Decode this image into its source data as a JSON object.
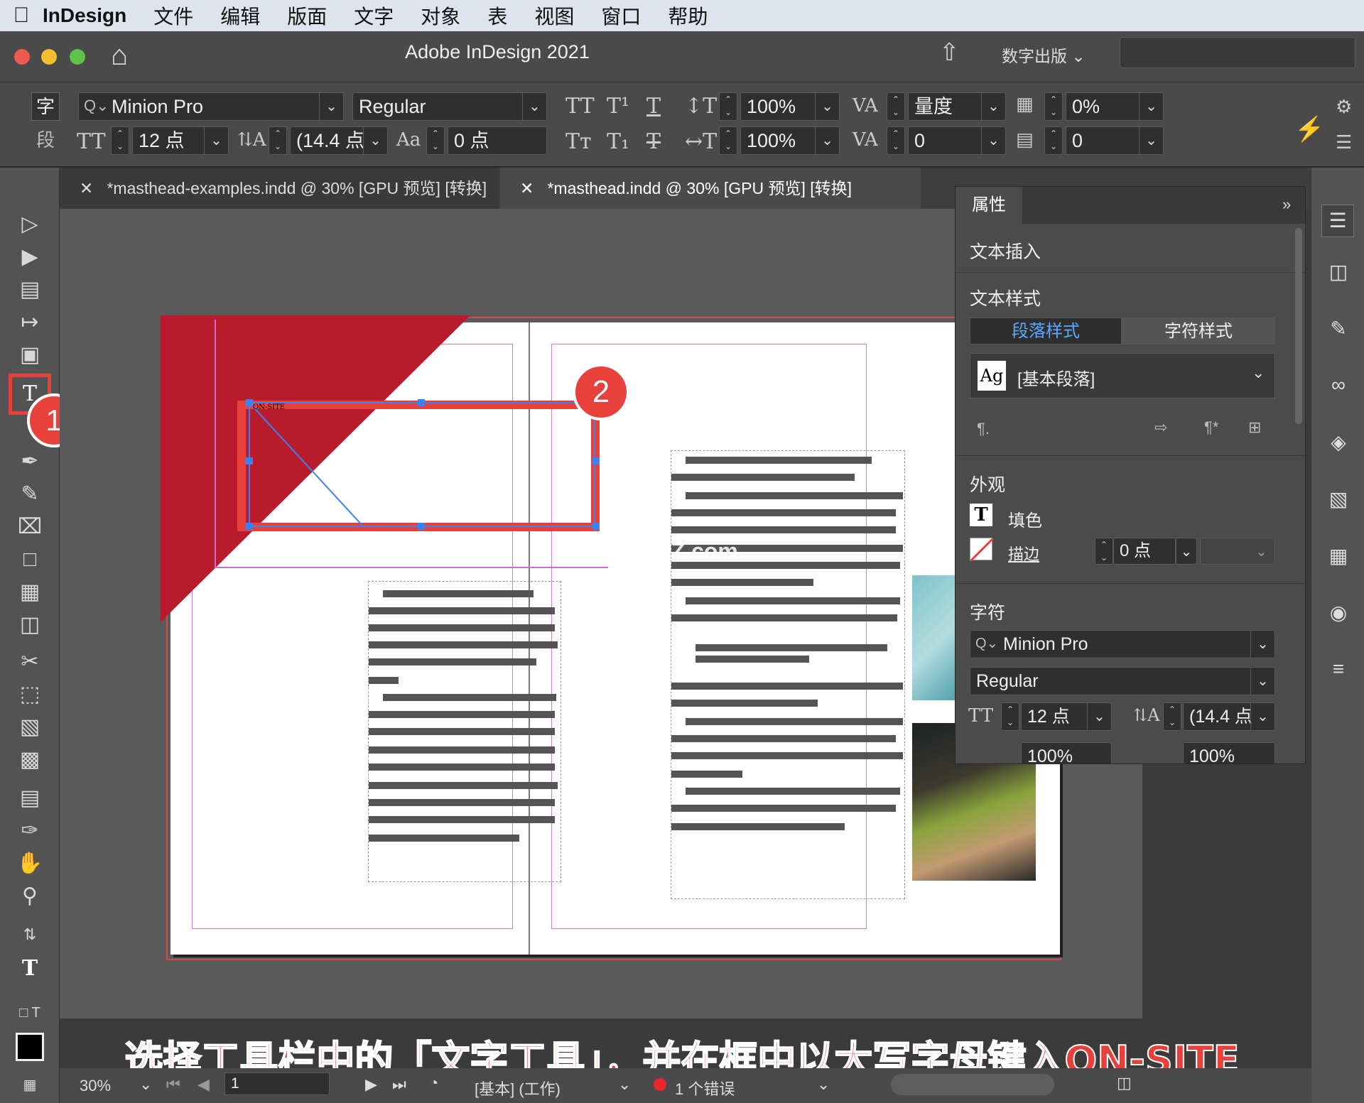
{
  "menubar": {
    "app": "InDesign",
    "items": [
      "文件",
      "编辑",
      "版面",
      "文字",
      "对象",
      "表",
      "视图",
      "窗口",
      "帮助"
    ]
  },
  "window": {
    "title": "Adobe InDesign 2021",
    "workspace": "数字出版"
  },
  "control": {
    "char_label": "字",
    "para_label": "段",
    "font": "Minion Pro",
    "style": "Regular",
    "size": "12 点",
    "leading": "(14.4 点",
    "baseline": "0 点",
    "vscale": "100%",
    "hscale": "100%",
    "kern": "量度",
    "track": "0",
    "skew": "0%",
    "skew2": "0"
  },
  "tabs": [
    {
      "label": "*masthead-examples.indd @ 30% [GPU 预览] [转换]"
    },
    {
      "label": "*masthead.indd @ 30% [GPU 预览] [转换]"
    }
  ],
  "properties": {
    "tab": "属性",
    "text_insert": "文本插入",
    "text_style": "文本样式",
    "para_style_tab": "段落样式",
    "char_style_tab": "字符样式",
    "para_style_value": "[基本段落]",
    "appearance": "外观",
    "fill": "填色",
    "stroke": "描边",
    "stroke_weight": "0 点",
    "character": "字符",
    "font": "Minion Pro",
    "style": "Regular",
    "size": "12 点",
    "leading": "(14.4 点",
    "vscale": "100%",
    "hscale": "100%"
  },
  "page": {
    "text": "ON-SITE"
  },
  "callouts": {
    "one": "1",
    "two": "2"
  },
  "watermark": "www.MacZ.com",
  "status": {
    "zoom": "30%",
    "page": "1",
    "style": "[基本]  (工作)",
    "errors": "1 个错误"
  },
  "caption": "选择工具栏中的「文字工具」，并在框中以大写字母键入ON-SITE",
  "colors": {
    "accent_red": "#e8413c",
    "page_red": "#b81c2c",
    "selection_blue": "#3b82f6"
  }
}
